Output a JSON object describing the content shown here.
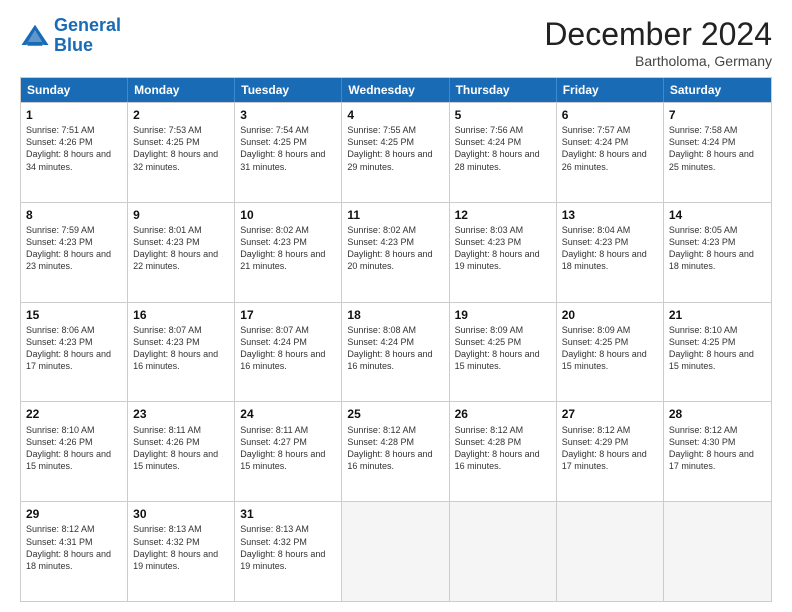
{
  "logo": {
    "line1": "General",
    "line2": "Blue"
  },
  "title": "December 2024",
  "location": "Bartholoma, Germany",
  "days_of_week": [
    "Sunday",
    "Monday",
    "Tuesday",
    "Wednesday",
    "Thursday",
    "Friday",
    "Saturday"
  ],
  "weeks": [
    [
      {
        "day": "1",
        "sunrise": "Sunrise: 7:51 AM",
        "sunset": "Sunset: 4:26 PM",
        "daylight": "Daylight: 8 hours and 34 minutes."
      },
      {
        "day": "2",
        "sunrise": "Sunrise: 7:53 AM",
        "sunset": "Sunset: 4:25 PM",
        "daylight": "Daylight: 8 hours and 32 minutes."
      },
      {
        "day": "3",
        "sunrise": "Sunrise: 7:54 AM",
        "sunset": "Sunset: 4:25 PM",
        "daylight": "Daylight: 8 hours and 31 minutes."
      },
      {
        "day": "4",
        "sunrise": "Sunrise: 7:55 AM",
        "sunset": "Sunset: 4:25 PM",
        "daylight": "Daylight: 8 hours and 29 minutes."
      },
      {
        "day": "5",
        "sunrise": "Sunrise: 7:56 AM",
        "sunset": "Sunset: 4:24 PM",
        "daylight": "Daylight: 8 hours and 28 minutes."
      },
      {
        "day": "6",
        "sunrise": "Sunrise: 7:57 AM",
        "sunset": "Sunset: 4:24 PM",
        "daylight": "Daylight: 8 hours and 26 minutes."
      },
      {
        "day": "7",
        "sunrise": "Sunrise: 7:58 AM",
        "sunset": "Sunset: 4:24 PM",
        "daylight": "Daylight: 8 hours and 25 minutes."
      }
    ],
    [
      {
        "day": "8",
        "sunrise": "Sunrise: 7:59 AM",
        "sunset": "Sunset: 4:23 PM",
        "daylight": "Daylight: 8 hours and 23 minutes."
      },
      {
        "day": "9",
        "sunrise": "Sunrise: 8:01 AM",
        "sunset": "Sunset: 4:23 PM",
        "daylight": "Daylight: 8 hours and 22 minutes."
      },
      {
        "day": "10",
        "sunrise": "Sunrise: 8:02 AM",
        "sunset": "Sunset: 4:23 PM",
        "daylight": "Daylight: 8 hours and 21 minutes."
      },
      {
        "day": "11",
        "sunrise": "Sunrise: 8:02 AM",
        "sunset": "Sunset: 4:23 PM",
        "daylight": "Daylight: 8 hours and 20 minutes."
      },
      {
        "day": "12",
        "sunrise": "Sunrise: 8:03 AM",
        "sunset": "Sunset: 4:23 PM",
        "daylight": "Daylight: 8 hours and 19 minutes."
      },
      {
        "day": "13",
        "sunrise": "Sunrise: 8:04 AM",
        "sunset": "Sunset: 4:23 PM",
        "daylight": "Daylight: 8 hours and 18 minutes."
      },
      {
        "day": "14",
        "sunrise": "Sunrise: 8:05 AM",
        "sunset": "Sunset: 4:23 PM",
        "daylight": "Daylight: 8 hours and 18 minutes."
      }
    ],
    [
      {
        "day": "15",
        "sunrise": "Sunrise: 8:06 AM",
        "sunset": "Sunset: 4:23 PM",
        "daylight": "Daylight: 8 hours and 17 minutes."
      },
      {
        "day": "16",
        "sunrise": "Sunrise: 8:07 AM",
        "sunset": "Sunset: 4:23 PM",
        "daylight": "Daylight: 8 hours and 16 minutes."
      },
      {
        "day": "17",
        "sunrise": "Sunrise: 8:07 AM",
        "sunset": "Sunset: 4:24 PM",
        "daylight": "Daylight: 8 hours and 16 minutes."
      },
      {
        "day": "18",
        "sunrise": "Sunrise: 8:08 AM",
        "sunset": "Sunset: 4:24 PM",
        "daylight": "Daylight: 8 hours and 16 minutes."
      },
      {
        "day": "19",
        "sunrise": "Sunrise: 8:09 AM",
        "sunset": "Sunset: 4:25 PM",
        "daylight": "Daylight: 8 hours and 15 minutes."
      },
      {
        "day": "20",
        "sunrise": "Sunrise: 8:09 AM",
        "sunset": "Sunset: 4:25 PM",
        "daylight": "Daylight: 8 hours and 15 minutes."
      },
      {
        "day": "21",
        "sunrise": "Sunrise: 8:10 AM",
        "sunset": "Sunset: 4:25 PM",
        "daylight": "Daylight: 8 hours and 15 minutes."
      }
    ],
    [
      {
        "day": "22",
        "sunrise": "Sunrise: 8:10 AM",
        "sunset": "Sunset: 4:26 PM",
        "daylight": "Daylight: 8 hours and 15 minutes."
      },
      {
        "day": "23",
        "sunrise": "Sunrise: 8:11 AM",
        "sunset": "Sunset: 4:26 PM",
        "daylight": "Daylight: 8 hours and 15 minutes."
      },
      {
        "day": "24",
        "sunrise": "Sunrise: 8:11 AM",
        "sunset": "Sunset: 4:27 PM",
        "daylight": "Daylight: 8 hours and 15 minutes."
      },
      {
        "day": "25",
        "sunrise": "Sunrise: 8:12 AM",
        "sunset": "Sunset: 4:28 PM",
        "daylight": "Daylight: 8 hours and 16 minutes."
      },
      {
        "day": "26",
        "sunrise": "Sunrise: 8:12 AM",
        "sunset": "Sunset: 4:28 PM",
        "daylight": "Daylight: 8 hours and 16 minutes."
      },
      {
        "day": "27",
        "sunrise": "Sunrise: 8:12 AM",
        "sunset": "Sunset: 4:29 PM",
        "daylight": "Daylight: 8 hours and 17 minutes."
      },
      {
        "day": "28",
        "sunrise": "Sunrise: 8:12 AM",
        "sunset": "Sunset: 4:30 PM",
        "daylight": "Daylight: 8 hours and 17 minutes."
      }
    ],
    [
      {
        "day": "29",
        "sunrise": "Sunrise: 8:12 AM",
        "sunset": "Sunset: 4:31 PM",
        "daylight": "Daylight: 8 hours and 18 minutes."
      },
      {
        "day": "30",
        "sunrise": "Sunrise: 8:13 AM",
        "sunset": "Sunset: 4:32 PM",
        "daylight": "Daylight: 8 hours and 19 minutes."
      },
      {
        "day": "31",
        "sunrise": "Sunrise: 8:13 AM",
        "sunset": "Sunset: 4:32 PM",
        "daylight": "Daylight: 8 hours and 19 minutes."
      },
      null,
      null,
      null,
      null
    ]
  ]
}
